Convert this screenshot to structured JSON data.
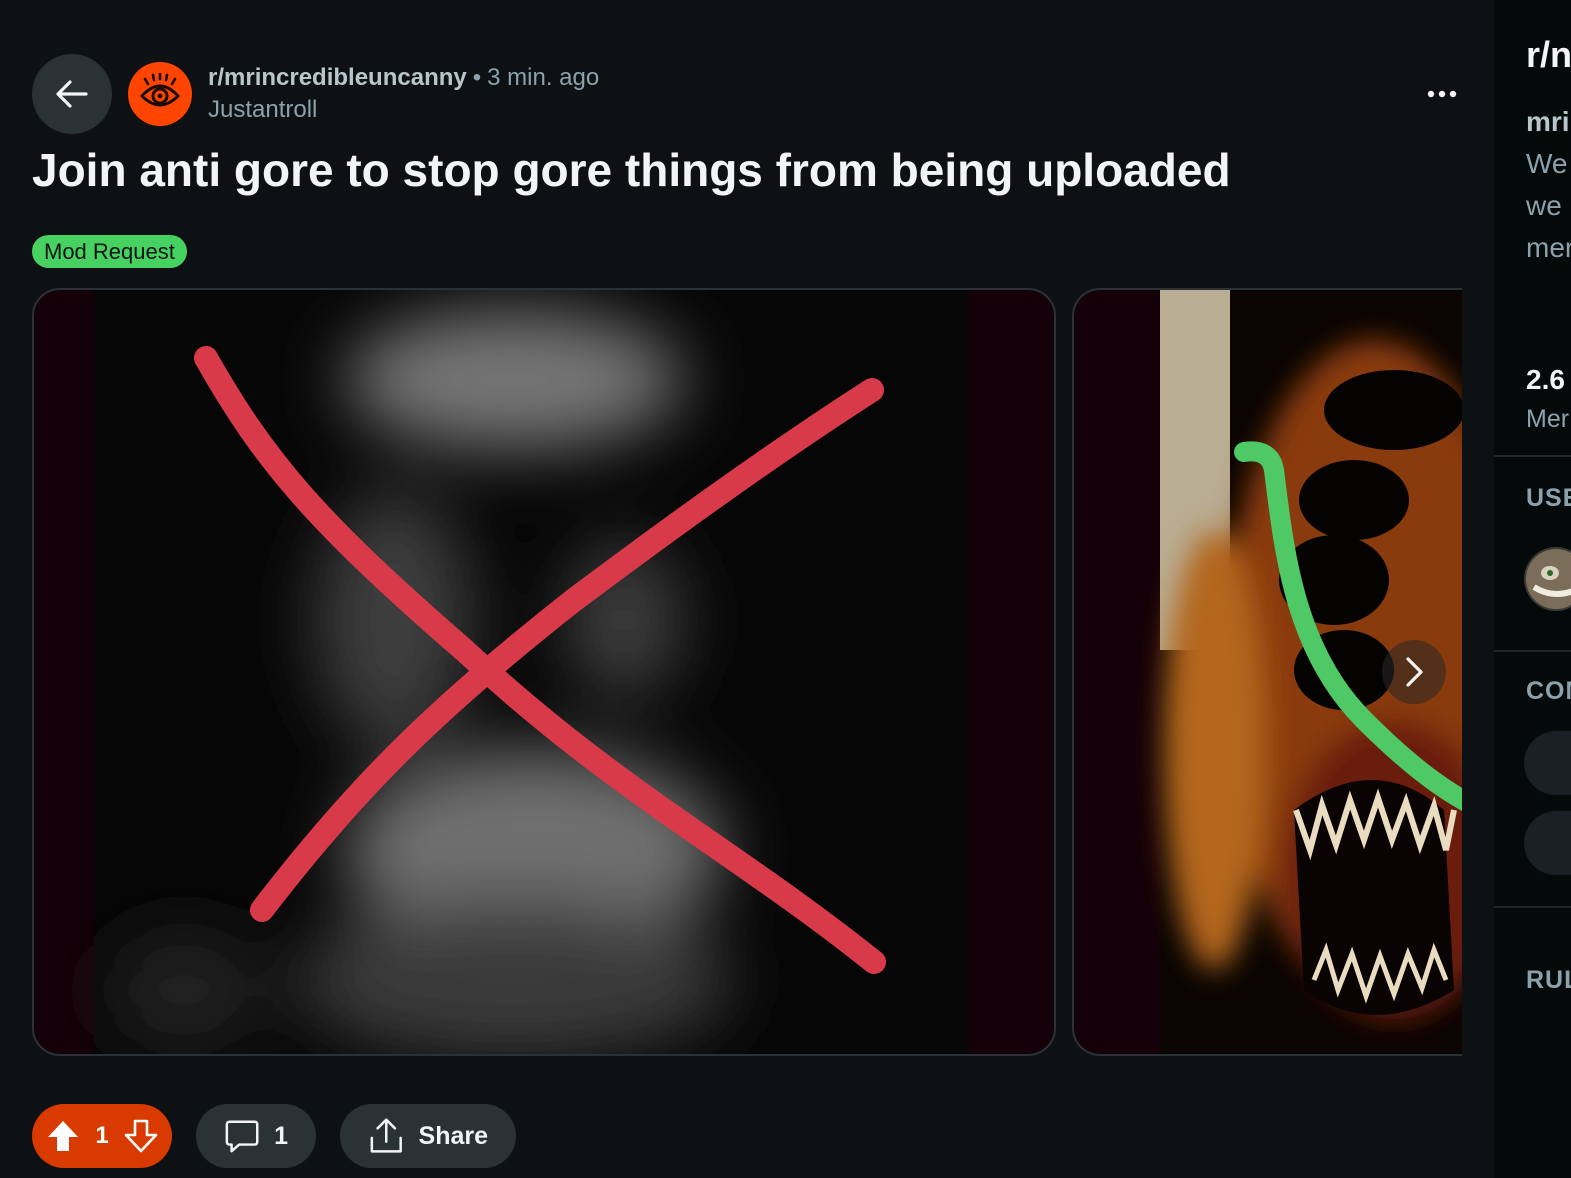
{
  "post": {
    "subreddit": "r/mrincredibleuncanny",
    "separator": "•",
    "time": "3 min. ago",
    "author": "Justantroll",
    "title": "Join anti gore to stop gore things from being uploaded",
    "flair": "Mod Request"
  },
  "actions": {
    "vote_count": "1",
    "comment_count": "1",
    "share_label": "Share"
  },
  "sidebar": {
    "title": "r/n",
    "name": "mri",
    "desc1": "We",
    "desc2": "we",
    "desc3": "mer",
    "stat": "2.6",
    "stat_label": "Mer",
    "section_user": "USE",
    "section_community": "COM",
    "section_rules": "RUL"
  },
  "colors": {
    "background": "#0e1113",
    "vote_pill": "#d93a00",
    "flair_bg": "#46d160",
    "subreddit_avatar": "#ff4500"
  },
  "icons": [
    "back-arrow-icon",
    "subreddit-eye-icon",
    "more-options-icon",
    "next-chevron-icon",
    "upvote-icon",
    "downvote-icon",
    "comment-icon",
    "share-icon"
  ]
}
